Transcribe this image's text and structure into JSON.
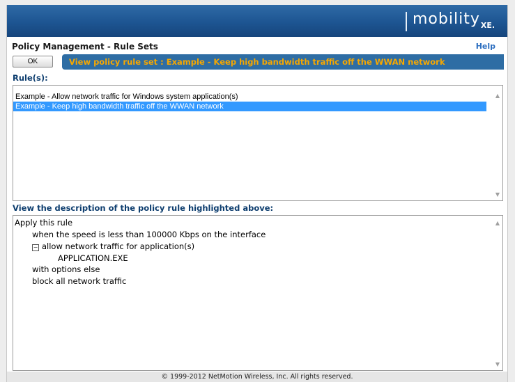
{
  "brand": {
    "name": "mobility",
    "suffix": "XE."
  },
  "header": {
    "title": "Policy Management - Rule Sets",
    "help_label": "Help"
  },
  "toolbar": {
    "ok_label": "OK",
    "heading": "View policy rule set  :  Example - Keep high bandwidth traffic off the WWAN network"
  },
  "rules": {
    "label": "Rule(s):",
    "items": [
      {
        "text": "Example - Allow network traffic for Windows system application(s)",
        "selected": false
      },
      {
        "text": "Example - Keep high bandwidth traffic off the WWAN network",
        "selected": true
      }
    ]
  },
  "description": {
    "label": "View the description of the policy rule highlighted above:",
    "lines": [
      "Apply this rule",
      "when the speed is less than 100000 Kbps on the interface",
      "allow network traffic for application(s)",
      "APPLICATION.EXE",
      "with options else",
      "block all network traffic"
    ]
  },
  "icons": {
    "collapse": "minus-box-icon",
    "scroll_up": "scroll-up-arrow-icon",
    "scroll_down": "scroll-down-arrow-icon"
  },
  "colors": {
    "banner": "#1d5592",
    "heading_pill": "#2e6da4",
    "heading_text": "#f7a800",
    "selection": "#3399ff",
    "section_label": "#0d3d6e",
    "help_link": "#2d6fc0"
  },
  "footer": {
    "copyright": "© 1999-2012 NetMotion Wireless, Inc. All rights reserved."
  }
}
